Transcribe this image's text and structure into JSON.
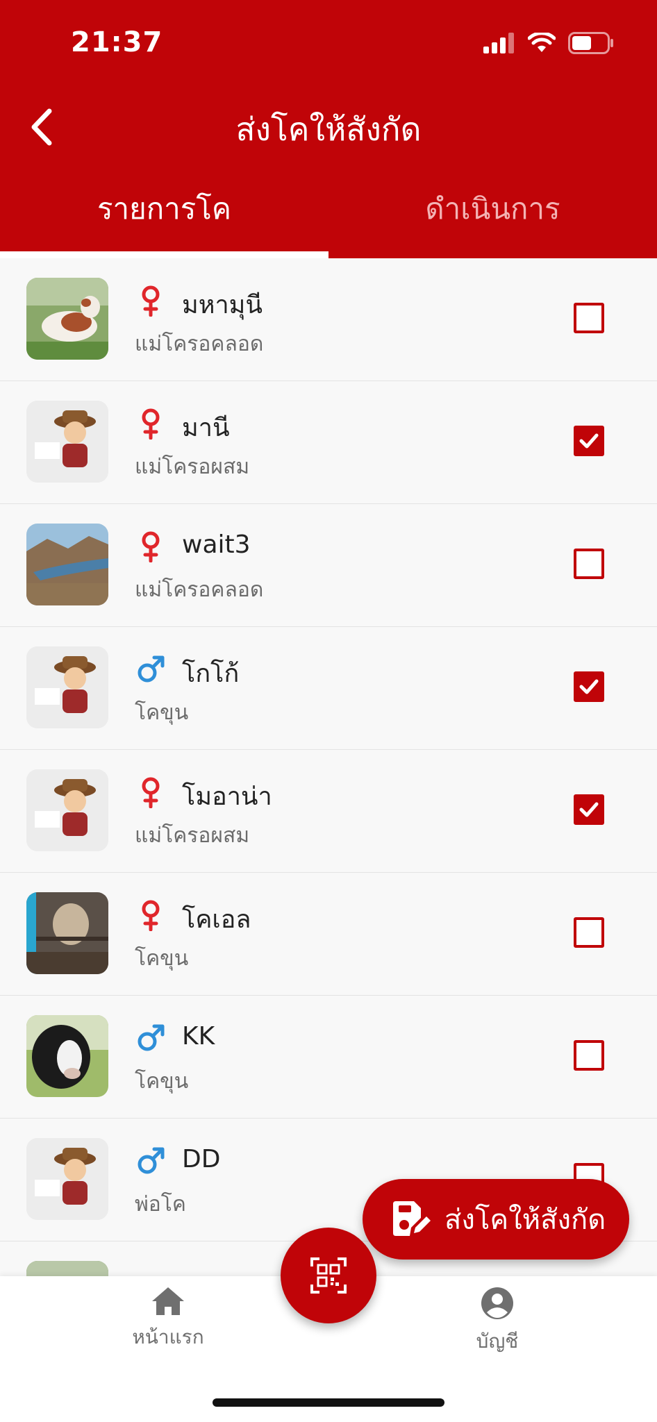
{
  "status_bar": {
    "time": "21:37"
  },
  "header": {
    "title": "ส่งโคให้สังกัด",
    "back_icon": "chevron-left-icon"
  },
  "tabs": [
    {
      "label": "รายการโค",
      "active": true
    },
    {
      "label": "ดำเนินการ",
      "active": false
    }
  ],
  "cows": [
    {
      "name": "มหามุนี",
      "sex": "female",
      "breed": "แม่โครอคลอด",
      "checked": false,
      "photo": "cow-photo"
    },
    {
      "name": "มานี",
      "sex": "female",
      "breed": "แม่โครอผสม",
      "checked": true,
      "photo": "farmer-cartoon"
    },
    {
      "name": "wait3",
      "sex": "female",
      "breed": "แม่โครอคลอด",
      "checked": false,
      "photo": "landscape-photo"
    },
    {
      "name": "โกโก้",
      "sex": "male",
      "breed": "โคขุน",
      "checked": true,
      "photo": "farmer-cartoon"
    },
    {
      "name": "โมอาน่า",
      "sex": "female",
      "breed": "แม่โครอผสม",
      "checked": true,
      "photo": "farmer-cartoon"
    },
    {
      "name": "โคเอล",
      "sex": "female",
      "breed": "โคขุน",
      "checked": false,
      "photo": "cow-photo"
    },
    {
      "name": "KK",
      "sex": "male",
      "breed": "โคขุน",
      "checked": false,
      "photo": "cow-photo"
    },
    {
      "name": "DD",
      "sex": "male",
      "breed": "พ่อโค",
      "checked": false,
      "photo": "farmer-cartoon"
    }
  ],
  "send_button": {
    "label": "ส่งโคให้สังกัด",
    "icon": "save-edit-icon"
  },
  "bottom_nav": {
    "home_label": "หน้าแรก",
    "account_label": "บัญชี",
    "qr_icon": "qr-scan-icon"
  },
  "colors": {
    "primary": "#c00408",
    "female": "#e0262b",
    "male": "#2f8fd8"
  }
}
